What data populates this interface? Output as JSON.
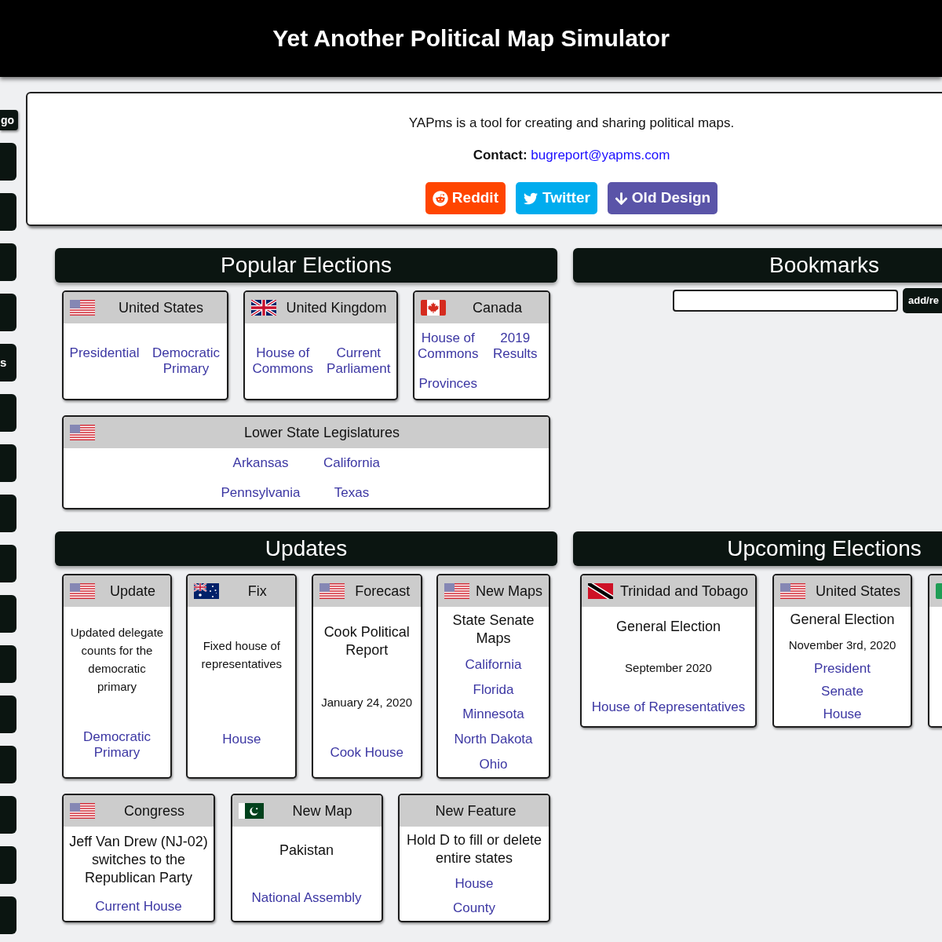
{
  "header": {
    "title": "Yet Another Political Map Simulator"
  },
  "sidebar": {
    "items": [
      {
        "kind": "small",
        "label": "go"
      },
      {
        "kind": "tile"
      },
      {
        "kind": "tile"
      },
      {
        "kind": "tile"
      },
      {
        "kind": "tile"
      },
      {
        "kind": "tile",
        "label": "s"
      },
      {
        "kind": "tile"
      },
      {
        "kind": "tile"
      },
      {
        "kind": "tile"
      },
      {
        "kind": "tile"
      },
      {
        "kind": "tile"
      },
      {
        "kind": "tile"
      },
      {
        "kind": "tile"
      },
      {
        "kind": "tile"
      },
      {
        "kind": "tile"
      },
      {
        "kind": "tile"
      },
      {
        "kind": "tile"
      }
    ]
  },
  "intro": {
    "text": "YAPms is a tool for creating and sharing political maps.",
    "contact_label": "Contact:",
    "contact_email": "bugreport@yapms.com",
    "buttons": [
      {
        "kind": "reddit",
        "label": "Reddit",
        "color": "#ff4500"
      },
      {
        "kind": "twitter",
        "label": "Twitter",
        "color": "#00acee"
      },
      {
        "kind": "old_design",
        "label": "Old Design",
        "color": "#5a54a8"
      }
    ]
  },
  "popular_elections": {
    "title": "Popular Elections",
    "rows": [
      {
        "cards": [
          {
            "title": "United States",
            "flag": {
              "kind": "us"
            },
            "links": [
              "Presidential",
              "Democratic Primary"
            ]
          },
          {
            "title": "United Kingdom",
            "flag": {
              "kind": "uk"
            },
            "links": [
              "House of Commons",
              "Current Parliament"
            ]
          },
          {
            "title": "Canada",
            "flag": {
              "kind": "ca"
            },
            "links": [
              "House of Commons",
              "2019 Results",
              "Provinces"
            ]
          }
        ]
      },
      {
        "cards": [
          {
            "title": "Lower State Legislatures",
            "flag": {
              "kind": "us"
            },
            "links": [
              "Arkansas",
              "California",
              "Pennsylvania",
              "Texas"
            ]
          }
        ]
      }
    ]
  },
  "bookmarks": {
    "title": "Bookmarks",
    "button_label": "add/re"
  },
  "updates": {
    "title": "Updates",
    "rows": [
      {
        "cards": [
          {
            "title": "Update",
            "flag": {
              "kind": "us"
            },
            "body": [
              {
                "kind": "text",
                "text": "Updated delegate counts for the democratic primary"
              },
              {
                "kind": "link",
                "text": "Democratic Primary"
              }
            ]
          },
          {
            "title": "Fix",
            "flag": {
              "kind": "au"
            },
            "body": [
              {
                "kind": "text",
                "text": "Fixed house of representatives"
              },
              {
                "kind": "link",
                "text": "House"
              }
            ]
          },
          {
            "title": "Forecast",
            "flag": {
              "kind": "us"
            },
            "body": [
              {
                "kind": "heading",
                "text": "Cook Political Report"
              },
              {
                "kind": "text",
                "text": "January 24, 2020"
              },
              {
                "kind": "link",
                "text": "Cook House"
              }
            ]
          },
          {
            "title": "New Maps",
            "flag": {
              "kind": "us"
            },
            "body": [
              {
                "kind": "heading",
                "text": "State Senate Maps"
              },
              {
                "kind": "link",
                "text": "California"
              },
              {
                "kind": "link",
                "text": "Florida"
              },
              {
                "kind": "link",
                "text": "Minnesota"
              },
              {
                "kind": "link",
                "text": "North Dakota"
              },
              {
                "kind": "link",
                "text": "Ohio"
              }
            ]
          }
        ]
      },
      {
        "cards": [
          {
            "title": "Congress",
            "flag": {
              "kind": "us"
            },
            "body": [
              {
                "kind": "heading",
                "text": "Jeff Van Drew (NJ-02) switches to the Republican Party"
              },
              {
                "kind": "link",
                "text": "Current House"
              }
            ]
          },
          {
            "title": "New Map",
            "flag": {
              "kind": "pk"
            },
            "body": [
              {
                "kind": "heading",
                "text": "Pakistan"
              },
              {
                "kind": "link",
                "text": "National Assembly"
              }
            ]
          },
          {
            "title": "New Feature",
            "body": [
              {
                "kind": "heading",
                "text": "Hold D to fill or delete entire states"
              },
              {
                "kind": "link",
                "text": "House"
              },
              {
                "kind": "link",
                "text": "County"
              }
            ]
          }
        ]
      }
    ]
  },
  "upcoming_elections": {
    "title": "Upcoming Elections",
    "cards": [
      {
        "title": "Trinidad and Tobago",
        "flag": {
          "kind": "tt"
        },
        "body": [
          {
            "kind": "heading",
            "text": "General Election"
          },
          {
            "kind": "text",
            "text": "September 2020"
          },
          {
            "kind": "link",
            "text": "House of Representatives"
          }
        ]
      },
      {
        "title": "United States",
        "flag": {
          "kind": "us"
        },
        "body": [
          {
            "kind": "heading",
            "text": "General Election"
          },
          {
            "kind": "text",
            "text": "November 3rd, 2020"
          },
          {
            "kind": "link",
            "text": "President"
          },
          {
            "kind": "link",
            "text": "Senate"
          },
          {
            "kind": "link",
            "text": "House"
          }
        ]
      },
      {
        "flag": {
          "kind": "partial"
        }
      }
    ]
  }
}
